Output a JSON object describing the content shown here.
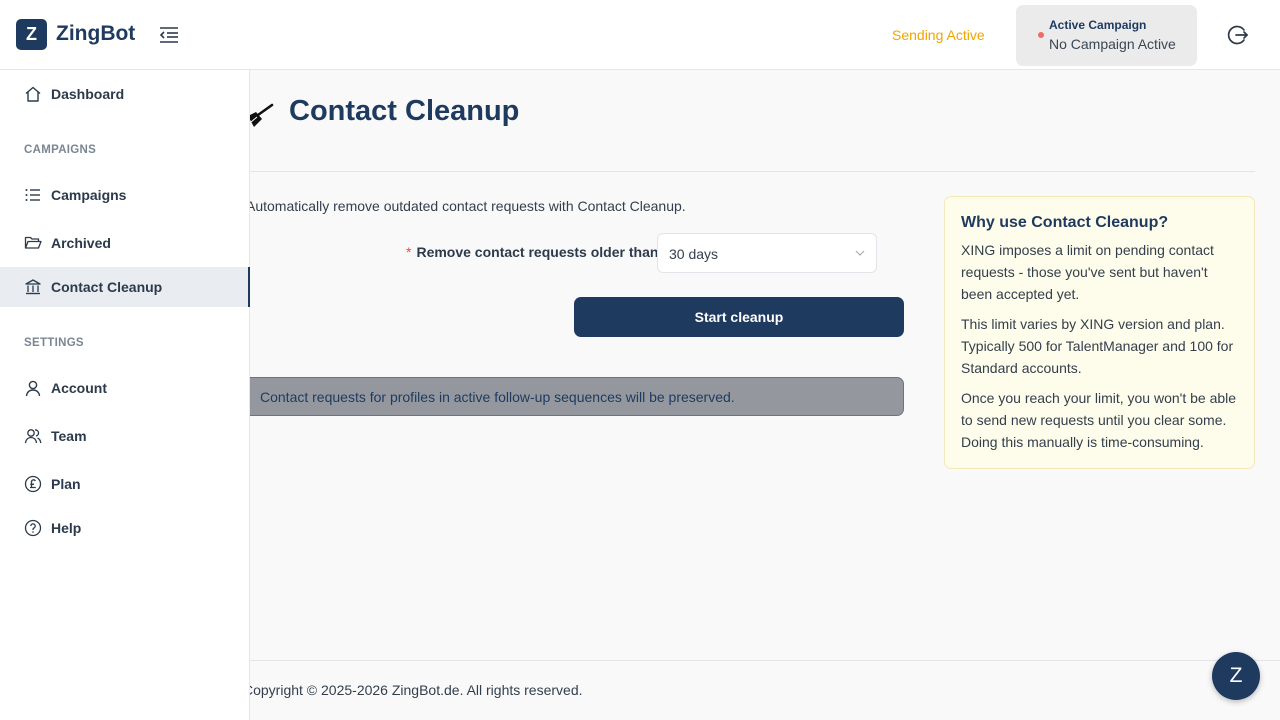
{
  "header": {
    "logo_letter": "Z",
    "app_name": "ZingBot",
    "sending_status": "Sending Active",
    "campaign_label": "Active Campaign",
    "campaign_value": "No Campaign Active"
  },
  "sidebar": {
    "dashboard": "Dashboard",
    "campaigns_section": "CAMPAIGNS",
    "campaigns": "Campaigns",
    "archived": "Archived",
    "contact_cleanup": "Contact Cleanup",
    "settings_section": "SETTINGS",
    "account": "Account",
    "team": "Team",
    "plan": "Plan",
    "help": "Help"
  },
  "main": {
    "title": "Contact Cleanup",
    "intro": "Automatically remove outdated contact requests with Contact Cleanup.",
    "required_mark": "*",
    "form_label": "Remove contact requests older than",
    "form_colon": ":",
    "select_value": "30 days",
    "start_button": "Start cleanup",
    "notice": "Contact requests for profiles in active follow-up sequences will be preserved."
  },
  "info": {
    "title": "Why use Contact Cleanup?",
    "p1": "XING imposes a limit on pending contact requests - those you've sent but haven't been accepted yet.",
    "p2": "This limit varies by XING version and plan. Typically 500 for TalentManager and 100 for Standard accounts.",
    "p3": "Once you reach your limit, you won't be able to send new requests until you clear some. Doing this manually is time-consuming."
  },
  "footer": {
    "copyright": "Copyright © 2025-2026 ZingBot.de. All rights reserved.",
    "chat_letter": "Z"
  },
  "colors": {
    "brand": "#1e3a5f",
    "sending_active": "#f0a500",
    "campaign_dot": "#f06a6a",
    "info_bg": "#fefcea"
  },
  "icons": {
    "collapse": "menu-fold-icon",
    "logout": "logout-icon",
    "dashboard": "home-icon",
    "campaigns": "list-icon",
    "archived": "folder-open-icon",
    "contact_cleanup": "bank-icon",
    "account": "user-icon",
    "team": "team-icon",
    "plan": "pound-circle-icon",
    "help": "question-circle-icon",
    "page": "broom-icon",
    "select": "chevron-down-icon"
  }
}
